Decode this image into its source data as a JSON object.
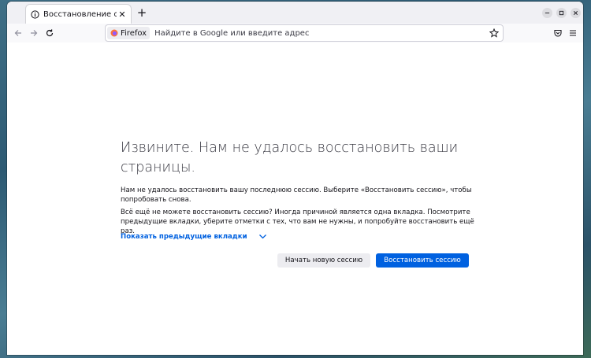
{
  "tab": {
    "title": "Восстановление сессии",
    "close_glyph": "✕",
    "icon": "info-icon"
  },
  "newtab_glyph": "+",
  "window_controls": [
    "minimize-icon",
    "maximize-icon",
    "close-icon"
  ],
  "urlbar": {
    "identity_label": "Firefox",
    "placeholder": "Найдите в Google или введите адрес"
  },
  "error": {
    "title": "Извините. Нам не удалось восстановить ваши страницы.",
    "paragraph1": "Нам не удалось восстановить вашу последнюю сессию. Выберите «Восстановить сессию», чтобы попробовать снова.",
    "paragraph2": "Всё ещё не можете восстановить сессию? Иногда причиной является одна вкладка. Посмотрите предыдущие вкладки, уберите отметки с тех, что вам не нужны, и попробуйте восстановить ещё раз.",
    "show_tabs_label": "Показать предыдущие вкладки",
    "new_session_button": "Начать новую сессию",
    "restore_button": "Восстановить сессию"
  },
  "colors": {
    "accent": "#0061e0",
    "tabbar_bg": "#f0f0f4",
    "secondary_button_bg": "#ececf0"
  }
}
